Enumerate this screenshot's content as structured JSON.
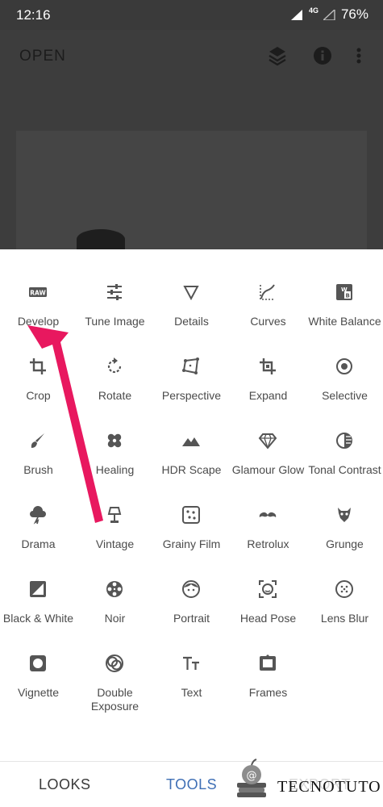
{
  "status_bar": {
    "time": "12:16",
    "network": "4G",
    "battery": "76%"
  },
  "app_bar": {
    "open_label": "OPEN",
    "icons": [
      "layers-icon",
      "info-icon",
      "more-vert-icon"
    ]
  },
  "tools": [
    {
      "id": "develop",
      "label": "Develop",
      "icon": "raw-icon"
    },
    {
      "id": "tune-image",
      "label": "Tune Image",
      "icon": "sliders-icon"
    },
    {
      "id": "details",
      "label": "Details",
      "icon": "triangle-icon"
    },
    {
      "id": "curves",
      "label": "Curves",
      "icon": "curves-icon"
    },
    {
      "id": "white-balance",
      "label": "White Balance",
      "icon": "wb-icon"
    },
    {
      "id": "crop",
      "label": "Crop",
      "icon": "crop-icon"
    },
    {
      "id": "rotate",
      "label": "Rotate",
      "icon": "rotate-icon"
    },
    {
      "id": "perspective",
      "label": "Perspective",
      "icon": "perspective-icon"
    },
    {
      "id": "expand",
      "label": "Expand",
      "icon": "expand-icon"
    },
    {
      "id": "selective",
      "label": "Selective",
      "icon": "selective-icon"
    },
    {
      "id": "brush",
      "label": "Brush",
      "icon": "brush-icon"
    },
    {
      "id": "healing",
      "label": "Healing",
      "icon": "bandage-icon"
    },
    {
      "id": "hdr-scape",
      "label": "HDR Scape",
      "icon": "mountains-icon"
    },
    {
      "id": "glamour-glow",
      "label": "Glamour Glow",
      "icon": "diamond-icon"
    },
    {
      "id": "tonal-contrast",
      "label": "Tonal Contrast",
      "icon": "tonal-icon"
    },
    {
      "id": "drama",
      "label": "Drama",
      "icon": "storm-cloud-icon"
    },
    {
      "id": "vintage",
      "label": "Vintage",
      "icon": "lamp-icon"
    },
    {
      "id": "grainy-film",
      "label": "Grainy Film",
      "icon": "grain-icon"
    },
    {
      "id": "retrolux",
      "label": "Retrolux",
      "icon": "mustache-icon"
    },
    {
      "id": "grunge",
      "label": "Grunge",
      "icon": "grunge-icon"
    },
    {
      "id": "black-white",
      "label": "Black & White",
      "icon": "bw-icon"
    },
    {
      "id": "noir",
      "label": "Noir",
      "icon": "film-reel-icon"
    },
    {
      "id": "portrait",
      "label": "Portrait",
      "icon": "face-icon"
    },
    {
      "id": "head-pose",
      "label": "Head Pose",
      "icon": "face-scan-icon"
    },
    {
      "id": "lens-blur",
      "label": "Lens Blur",
      "icon": "lens-blur-icon"
    },
    {
      "id": "vignette",
      "label": "Vignette",
      "icon": "vignette-icon"
    },
    {
      "id": "double-exposure",
      "label": "Double Exposure",
      "icon": "double-exposure-icon"
    },
    {
      "id": "text",
      "label": "Text",
      "icon": "text-icon"
    },
    {
      "id": "frames",
      "label": "Frames",
      "icon": "frames-icon"
    }
  ],
  "bottom_nav": {
    "looks": "LOOKS",
    "tools": "TOOLS",
    "export": "EXPORT",
    "active": "tools",
    "active_color": "#3f6fb5"
  },
  "watermark": {
    "text": "TECNOTUTO"
  },
  "colors": {
    "arrow": "#e8185f",
    "icon": "#555555",
    "label": "#4b4b4b"
  }
}
